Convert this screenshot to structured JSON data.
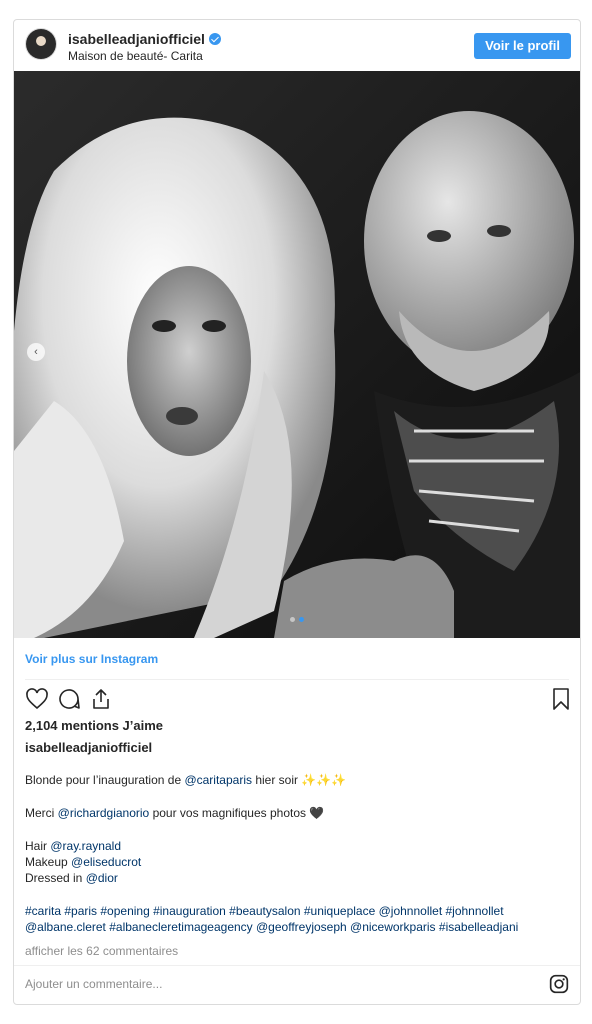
{
  "header": {
    "username": "isabelleadjaniofficiel",
    "subtitle": "Maison de beauté- Carita",
    "profile_button": "Voir le profil"
  },
  "photo": {
    "carousel_count": 2,
    "carousel_active_index": 1
  },
  "more_link": "Voir plus sur Instagram",
  "likes": "2,104 mentions J’aime",
  "author": "isabelleadjaniofficiel",
  "caption": {
    "line1_text": "Blonde pour l’inauguration de ",
    "line1_mention": "@caritaparis",
    "line1_suffix": " hier soir ✨✨✨",
    "line2_text": "Merci ",
    "line2_mention": "@richardgianorio",
    "line2_suffix": " pour vos magnifiques photos 🖤",
    "hair_label": "Hair ",
    "hair_mention": "@ray.raynald",
    "makeup_label": "Makeup ",
    "makeup_mention": "@eliseducrot",
    "dressed_label": "Dressed in ",
    "dressed_mention": "@dior",
    "hashtags_line1": "#carita #paris #opening #inauguration #beautysalon #uniqueplace @johnnollet #johnnollet",
    "hashtags_line2": "@albane.cleret #albanecleretimageagency @geoffreyjoseph @niceworkparis #isabelleadjani"
  },
  "comments_link": "afficher les 62 commentaires",
  "comment_input": {
    "placeholder": "Ajouter un commentaire..."
  },
  "icons": {
    "heart": "heart-icon",
    "comment": "comment-icon",
    "share": "share-icon",
    "bookmark": "bookmark-icon",
    "instagram": "instagram-icon",
    "verified": "verified-badge-icon",
    "prev": "chevron-left-icon"
  },
  "colors": {
    "accent": "#3897f0",
    "mention": "#003569",
    "muted": "#8e8e8e",
    "text": "#262626",
    "border": "#dbdbdb"
  }
}
